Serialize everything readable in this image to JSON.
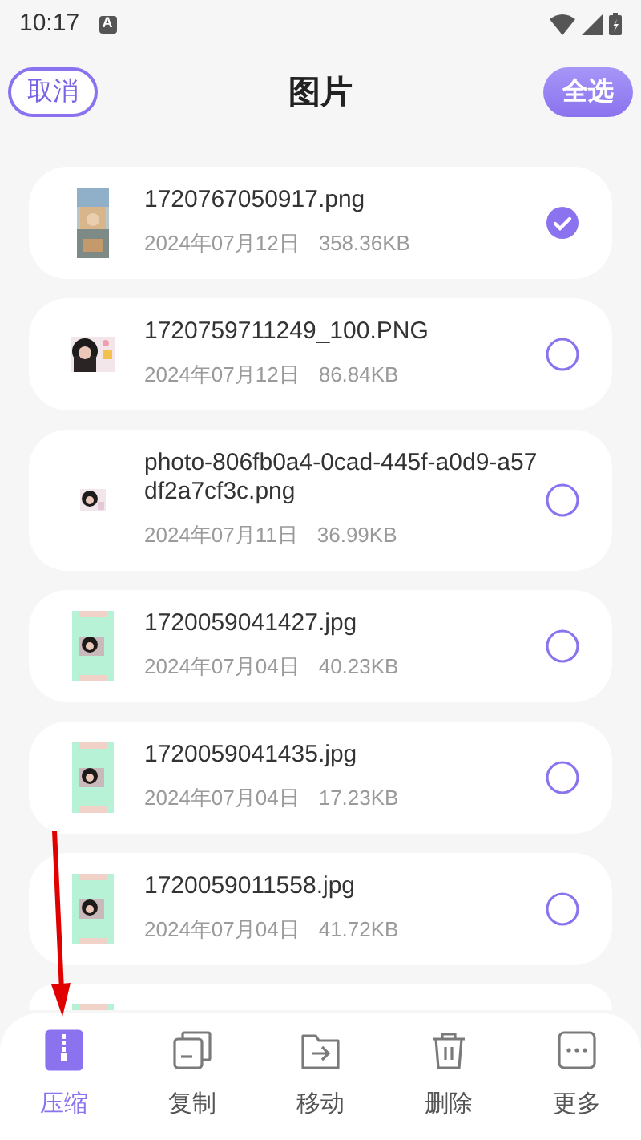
{
  "status_bar": {
    "time": "10:17",
    "notification": "A"
  },
  "header": {
    "cancel": "取消",
    "title": "图片",
    "select_all": "全选"
  },
  "files": [
    {
      "name": "1720767050917.png",
      "date": "2024年07月12日",
      "size": "358.36KB",
      "selected": true
    },
    {
      "name": "1720759711249_100.PNG",
      "date": "2024年07月12日",
      "size": "86.84KB",
      "selected": false
    },
    {
      "name": "photo-806fb0a4-0cad-445f-a0d9-a57df2a7cf3c.png",
      "date": "2024年07月11日",
      "size": "36.99KB",
      "selected": false
    },
    {
      "name": "1720059041427.jpg",
      "date": "2024年07月04日",
      "size": "40.23KB",
      "selected": false
    },
    {
      "name": "1720059041435.jpg",
      "date": "2024年07月04日",
      "size": "17.23KB",
      "selected": false
    },
    {
      "name": "1720059011558.jpg",
      "date": "2024年07月04日",
      "size": "41.72KB",
      "selected": false
    }
  ],
  "bottom_tabs": [
    {
      "label": "压缩",
      "selected": true
    },
    {
      "label": "复制",
      "selected": false
    },
    {
      "label": "移动",
      "selected": false
    },
    {
      "label": "删除",
      "selected": false
    },
    {
      "label": "更多",
      "selected": false
    }
  ]
}
